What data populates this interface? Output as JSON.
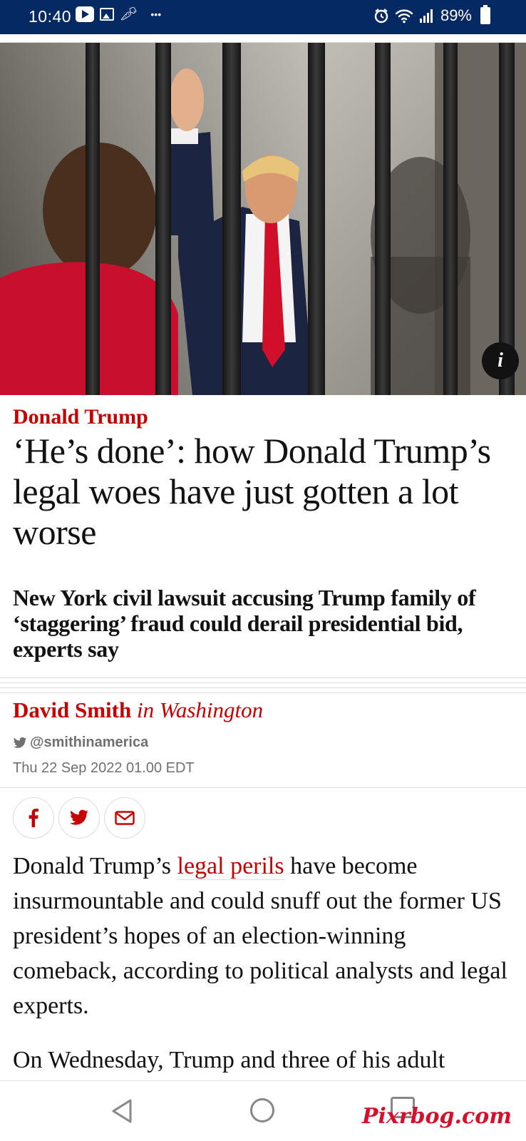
{
  "status_bar": {
    "time": "10:40",
    "left_icons": [
      "youtube-icon",
      "gallery-icon",
      "carrot-icon",
      "more-dots-icon"
    ],
    "right_icons": [
      "alarm-icon",
      "wifi-icon",
      "signal-icon"
    ],
    "battery_text": "89%",
    "background_color": "#052962"
  },
  "hero_image": {
    "description_icon": "info-icon",
    "info_label": "i"
  },
  "article": {
    "kicker": "Donald Trump",
    "headline": "‘He’s done’: how Donald Trump’s legal woes have just gotten a lot worse",
    "standfirst": "New York civil lawsuit accusing Trump family of ‘staggering’ fraud could derail presidential bid, experts say",
    "byline_name": "David Smith",
    "byline_location": "in Washington",
    "twitter_handle": "@smithinamerica",
    "date": "Thu 22 Sep 2022 01.00 EDT",
    "share_buttons": [
      "facebook-icon",
      "twitter-icon",
      "email-icon"
    ],
    "body": {
      "p1_before": "Donald Trump’s ",
      "p1_link": "legal perils",
      "p1_after": " have become insurmountable and could snuff out the former US president’s hopes of an election-winning comeback, according to political analysts and legal experts.",
      "p2": "On Wednesday, Trump and three of his adult"
    },
    "accent_color": "#c70000"
  },
  "nav_bar": {
    "buttons": [
      "back-icon",
      "home-icon",
      "recent-apps-icon"
    ]
  },
  "watermark": "Pixrbog.com"
}
